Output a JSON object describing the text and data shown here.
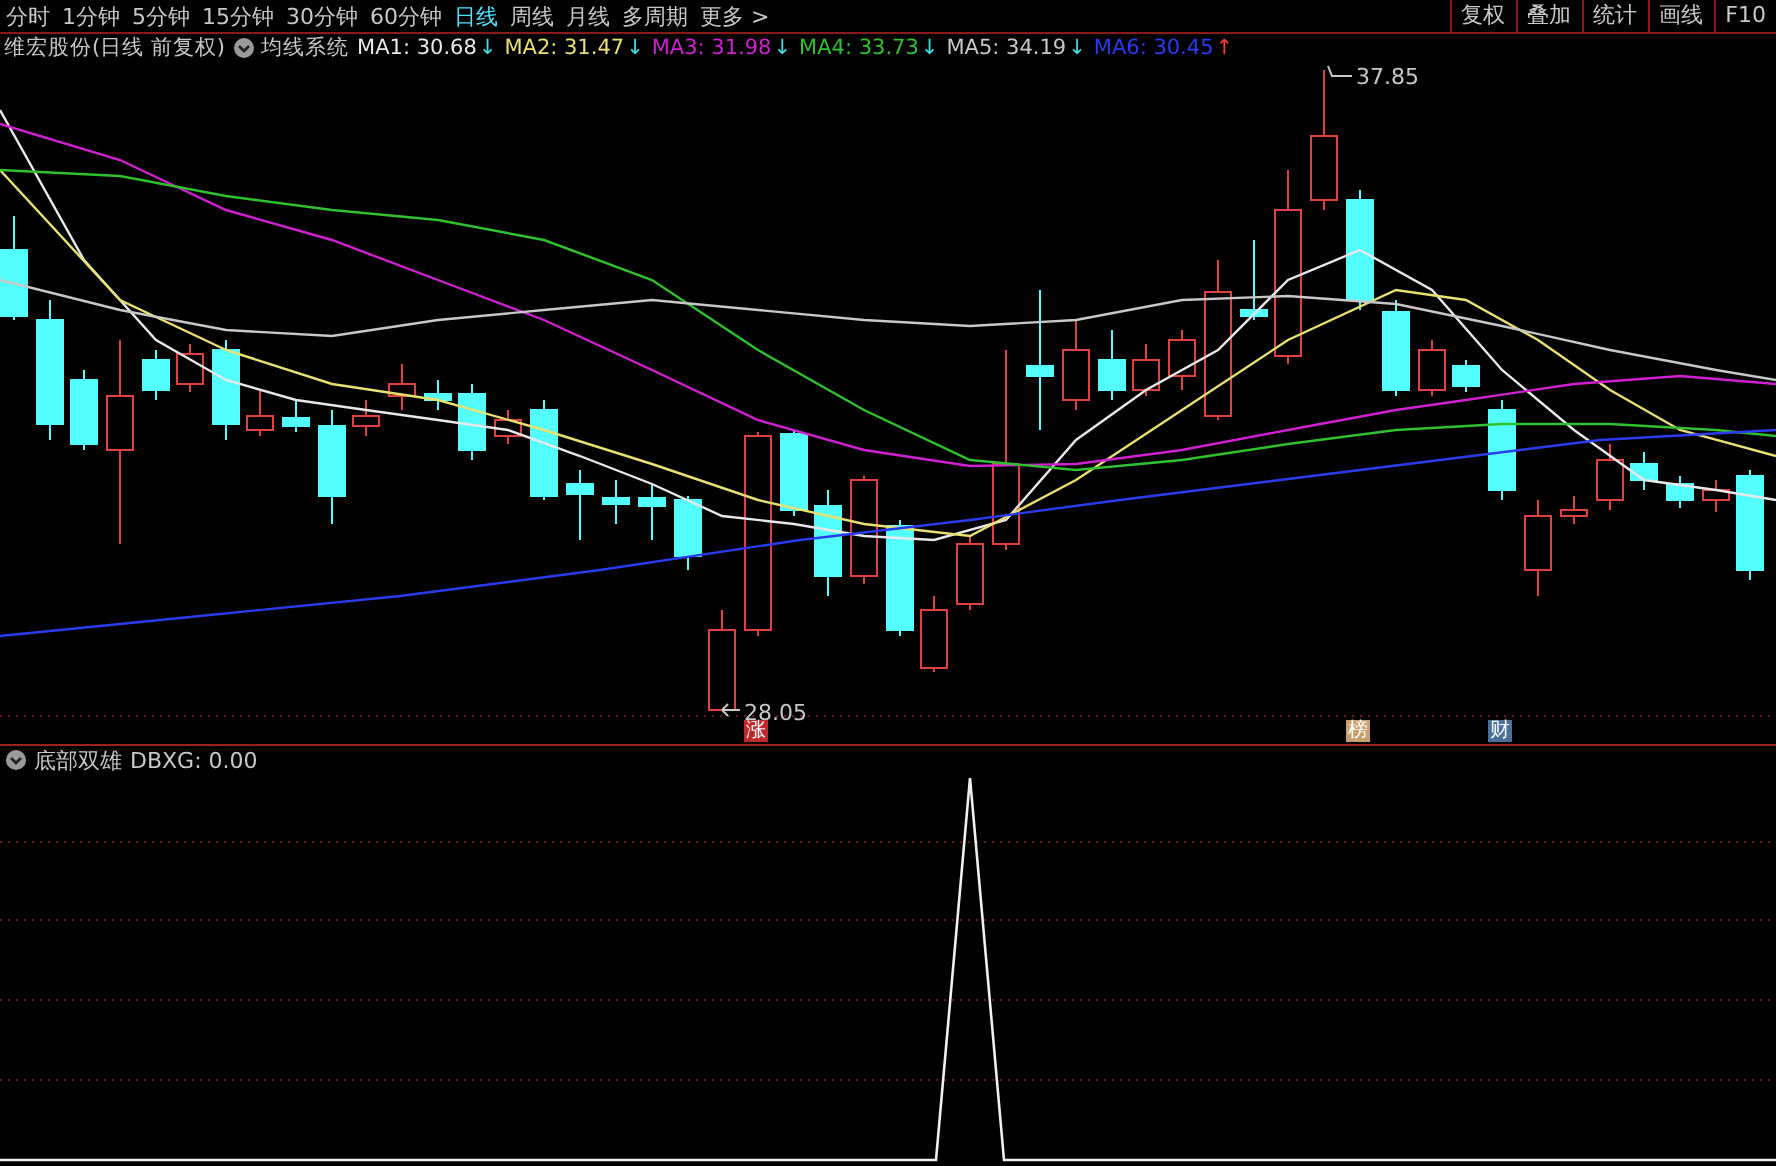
{
  "period_tabs": [
    {
      "label": "分时",
      "selected": false
    },
    {
      "label": "1分钟",
      "selected": false
    },
    {
      "label": "5分钟",
      "selected": false
    },
    {
      "label": "15分钟",
      "selected": false
    },
    {
      "label": "30分钟",
      "selected": false
    },
    {
      "label": "60分钟",
      "selected": false
    },
    {
      "label": "日线",
      "selected": true
    },
    {
      "label": "周线",
      "selected": false
    },
    {
      "label": "月线",
      "selected": false
    },
    {
      "label": "多周期",
      "selected": false
    },
    {
      "label": "更多 >",
      "selected": false
    }
  ],
  "tool_buttons": [
    "复权",
    "叠加",
    "统计",
    "画线",
    "F10"
  ],
  "stock_title": "维宏股份(日线 前复权)",
  "indicator_name": "均线系统",
  "ma_readings": [
    {
      "label": "MA1: 30.68",
      "arrow": "↓",
      "rising": false,
      "color": "#e8e8e8"
    },
    {
      "label": "MA2: 31.47",
      "arrow": "↓",
      "rising": false,
      "color": "#e8e070"
    },
    {
      "label": "MA3: 31.98",
      "arrow": "↓",
      "rising": false,
      "color": "#d020d0"
    },
    {
      "label": "MA4: 33.73",
      "arrow": "↓",
      "rising": false,
      "color": "#30c030"
    },
    {
      "label": "MA5: 34.19",
      "arrow": "↓",
      "rising": false,
      "color": "#c8c8c8"
    },
    {
      "label": "MA6: 30.45",
      "arrow": "↑",
      "rising": true,
      "color": "#2a3cf0"
    }
  ],
  "price_chart": {
    "high_label": "37.85",
    "low_label": "28.05",
    "event_markers": [
      {
        "text": "涨",
        "color": "#c0282d"
      },
      {
        "text": "榜",
        "color": "#c8a070"
      },
      {
        "text": "财",
        "color": "#4a6f98"
      }
    ]
  },
  "sub_indicator": {
    "name": "底部双雄",
    "reading": "DBXG: 0.00"
  }
}
